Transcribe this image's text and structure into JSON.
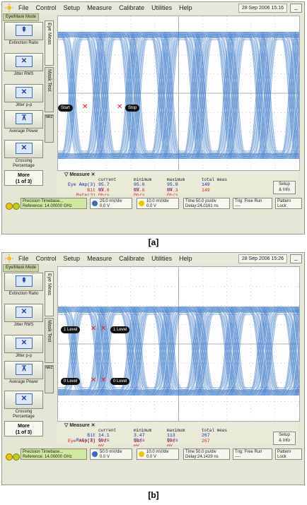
{
  "menu": [
    "File",
    "Control",
    "Setup",
    "Measure",
    "Calibrate",
    "Utilities",
    "Help"
  ],
  "mode_tab": "Eye/Mask Mode",
  "left_buttons": [
    "Extinction Ratio",
    "Jitter RMS",
    "Jitter p-p",
    "Average Power",
    "Crossing Percentage"
  ],
  "more": {
    "line1": "More",
    "line2": "(1 of 3)"
  },
  "vtabs": {
    "eye": "Eye Meas",
    "mask": "Mask Test",
    "nrz": "NRZ"
  },
  "measure_title": "Measure",
  "measure_headers": [
    "current",
    "minimum",
    "maximum",
    "total meas"
  ],
  "setup_info": {
    "line1": "Setup",
    "line2": "& Info"
  },
  "pattern_lock": {
    "line1": "Pattern",
    "line2": "Lock"
  },
  "timebase": {
    "line1": "Precision Timebase...",
    "line2": "Reference: 14.00000 GHz"
  },
  "trig": {
    "label": "Trig: Free Run",
    "sub": "----"
  },
  "panels": [
    {
      "datetime": "28 Sep 2006  15:16",
      "ch1": {
        "line1": "25.0 mV/div",
        "line2": "0.0 V"
      },
      "ch2": {
        "line1": "10.0 mV/div",
        "line2": "0.0 V"
      },
      "time": {
        "line1": "Time 50.0 ps/div",
        "line2": "Delay:24.0161 ns"
      },
      "markers": {
        "left": "Start",
        "right": "Stop"
      },
      "rows": [
        {
          "name": "Eye Amp(3)",
          "current": "95.7 mV",
          "minimum": "95.6 mV",
          "maximum": "95.8 mV",
          "total": "149",
          "color": "#1a2ab0"
        },
        {
          "name": "Bit Rate(3)",
          "current": "13.8 Gb/s",
          "minimum": "13.6 Gb/s",
          "maximum": "14.3 Gb/s",
          "total": "149",
          "color": "#d02020"
        }
      ],
      "caption": "[a]"
    },
    {
      "datetime": "28 Sep 2006  15:26",
      "ch1": {
        "line1": "50.0 mV/div",
        "line2": "0.0 V"
      },
      "ch2": {
        "line1": "10.0 mV/div",
        "line2": "0.0 V"
      },
      "time": {
        "line1": "Time 50.0 ps/div",
        "line2": "Delay:24.1429 ns"
      },
      "markers": {
        "left": "1 Level",
        "right": "1 Level",
        "left2": "0 Level",
        "right2": "0 Level"
      },
      "rows": [
        {
          "name": "Bit Rate(3)",
          "current": "14.1 Gb/s",
          "minimum": "3.47 Gb/s",
          "maximum": "113 Gb/s",
          "total": "267",
          "color": "#1a2ab0"
        },
        {
          "name": "Eye Amp(3)",
          "current": "173 mV",
          "minimum": "113 mV",
          "maximum": "173 mV",
          "total": "267",
          "color": "#d02020"
        }
      ],
      "caption": "[b]"
    }
  ],
  "colors": {
    "trace": "#3a78c8",
    "grid": "#9aa0a8"
  }
}
